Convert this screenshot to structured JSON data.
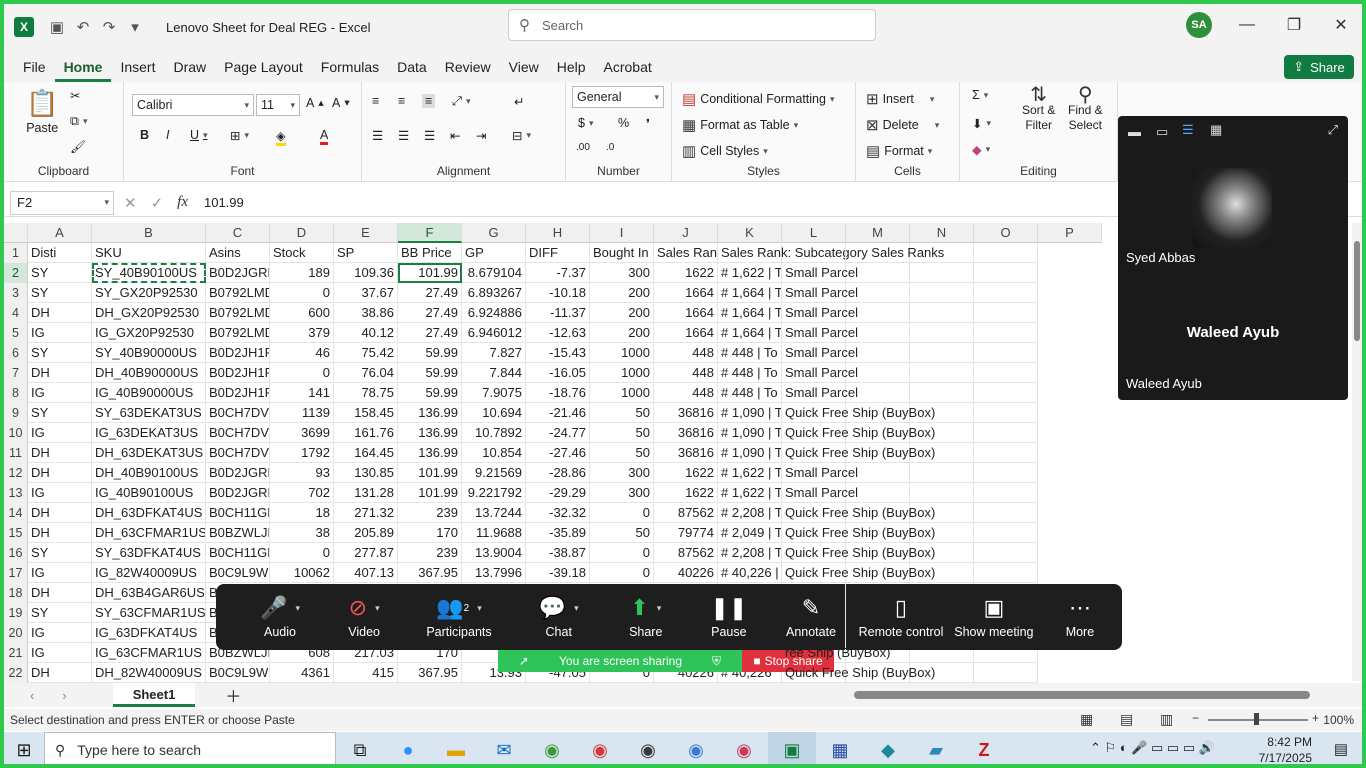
{
  "app": {
    "title": "Lenovo Sheet for Deal REG  -  Excel",
    "search_placeholder": "Search",
    "user_initials": "SA",
    "share_label": "Share"
  },
  "ribbon_tabs": [
    "File",
    "Home",
    "Insert",
    "Draw",
    "Page Layout",
    "Formulas",
    "Data",
    "Review",
    "View",
    "Help",
    "Acrobat"
  ],
  "ribbon": {
    "clipboard": {
      "paste": "Paste",
      "label": "Clipboard"
    },
    "font": {
      "name": "Calibri",
      "size": "11",
      "label": "Font"
    },
    "alignment": {
      "label": "Alignment"
    },
    "number": {
      "format": "General",
      "label": "Number"
    },
    "styles": {
      "conditional": "Conditional Formatting",
      "format_table": "Format as Table",
      "cell_styles": "Cell Styles",
      "label": "Styles"
    },
    "cells": {
      "insert": "Insert",
      "delete": "Delete",
      "format": "Format",
      "label": "Cells"
    },
    "editing": {
      "sort": "Sort &",
      "filter": "Filter",
      "find": "Find &",
      "select": "Select",
      "label": "Editing"
    }
  },
  "formula_bar": {
    "name_box": "F2",
    "value": "101.99"
  },
  "columns": [
    "A",
    "B",
    "C",
    "D",
    "E",
    "F",
    "G",
    "H",
    "I",
    "J",
    "K",
    "L",
    "M",
    "N",
    "O",
    "P"
  ],
  "rows": [
    {
      "n": "1",
      "cells": [
        "Disti",
        "SKU",
        "Asins",
        "Stock",
        "SP",
        "BB Price",
        "GP",
        "DIFF",
        "Bought In",
        "Sales Ranl",
        "Sales Rank: Subcategory Sales Ranks",
        "",
        "",
        "",
        ""
      ]
    },
    {
      "n": "2",
      "cells": [
        "SY",
        "SY_40B90100US",
        "B0D2JGRK",
        "189",
        "109.36",
        "101.99",
        "8.679104",
        "-7.37",
        "300",
        "1622",
        "# 1,622  |  T",
        "Small Parcel",
        "",
        "",
        ""
      ]
    },
    {
      "n": "3",
      "cells": [
        "SY",
        "SY_GX20P92530",
        "B0792LMD",
        "0",
        "37.67",
        "27.49",
        "6.893267",
        "-10.18",
        "200",
        "1664",
        "# 1,664  |  T",
        "Small Parcel",
        "",
        "",
        ""
      ]
    },
    {
      "n": "4",
      "cells": [
        "DH",
        "DH_GX20P92530",
        "B0792LMD",
        "600",
        "38.86",
        "27.49",
        "6.924886",
        "-11.37",
        "200",
        "1664",
        "# 1,664  |  T",
        "Small Parcel",
        "",
        "",
        ""
      ]
    },
    {
      "n": "5",
      "cells": [
        "IG",
        "IG_GX20P92530",
        "B0792LMD",
        "379",
        "40.12",
        "27.49",
        "6.946012",
        "-12.63",
        "200",
        "1664",
        "# 1,664  |  T",
        "Small Parcel",
        "",
        "",
        ""
      ]
    },
    {
      "n": "6",
      "cells": [
        "SY",
        "SY_40B90000US",
        "B0D2JH1R",
        "46",
        "75.42",
        "59.99",
        "7.827",
        "-15.43",
        "1000",
        "448",
        "# 448  |  To",
        "Small Parcel",
        "",
        "",
        ""
      ]
    },
    {
      "n": "7",
      "cells": [
        "DH",
        "DH_40B90000US",
        "B0D2JH1R",
        "0",
        "76.04",
        "59.99",
        "7.844",
        "-16.05",
        "1000",
        "448",
        "# 448  |  To",
        "Small Parcel",
        "",
        "",
        ""
      ]
    },
    {
      "n": "8",
      "cells": [
        "IG",
        "IG_40B90000US",
        "B0D2JH1R",
        "141",
        "78.75",
        "59.99",
        "7.9075",
        "-18.76",
        "1000",
        "448",
        "# 448  |  To",
        "Small Parcel",
        "",
        "",
        ""
      ]
    },
    {
      "n": "9",
      "cells": [
        "SY",
        "SY_63DEKAT3US",
        "B0CH7DVI",
        "1139",
        "158.45",
        "136.99",
        "10.694",
        "-21.46",
        "50",
        "36816",
        "# 1,090  |  T",
        "Quick Free Ship (BuyBox)",
        "",
        "",
        ""
      ]
    },
    {
      "n": "10",
      "cells": [
        "IG",
        "IG_63DEKAT3US",
        "B0CH7DVI",
        "3699",
        "161.76",
        "136.99",
        "10.7892",
        "-24.77",
        "50",
        "36816",
        "# 1,090  |  T",
        "Quick Free Ship (BuyBox)",
        "",
        "",
        ""
      ]
    },
    {
      "n": "11",
      "cells": [
        "DH",
        "DH_63DEKAT3US",
        "B0CH7DVI",
        "1792",
        "164.45",
        "136.99",
        "10.854",
        "-27.46",
        "50",
        "36816",
        "# 1,090  |  T",
        "Quick Free Ship (BuyBox)",
        "",
        "",
        ""
      ]
    },
    {
      "n": "12",
      "cells": [
        "DH",
        "DH_40B90100US",
        "B0D2JGRK",
        "93",
        "130.85",
        "101.99",
        "9.21569",
        "-28.86",
        "300",
        "1622",
        "# 1,622  |  T",
        "Small Parcel",
        "",
        "",
        ""
      ]
    },
    {
      "n": "13",
      "cells": [
        "IG",
        "IG_40B90100US",
        "B0D2JGRK",
        "702",
        "131.28",
        "101.99",
        "9.221792",
        "-29.29",
        "300",
        "1622",
        "# 1,622  |  T",
        "Small Parcel",
        "",
        "",
        ""
      ]
    },
    {
      "n": "14",
      "cells": [
        "DH",
        "DH_63DFKAT4US",
        "B0CH11GL",
        "18",
        "271.32",
        "239",
        "13.7244",
        "-32.32",
        "0",
        "87562",
        "# 2,208  |  T",
        "Quick Free Ship (BuyBox)",
        "",
        "",
        ""
      ]
    },
    {
      "n": "15",
      "cells": [
        "DH",
        "DH_63CFMAR1US",
        "B0BZWLJF",
        "38",
        "205.89",
        "170",
        "11.9688",
        "-35.89",
        "50",
        "79774",
        "# 2,049  |  T",
        "Quick Free Ship (BuyBox)",
        "",
        "",
        ""
      ]
    },
    {
      "n": "16",
      "cells": [
        "SY",
        "SY_63DFKAT4US",
        "B0CH11GL",
        "0",
        "277.87",
        "239",
        "13.9004",
        "-38.87",
        "0",
        "87562",
        "# 2,208  |  T",
        "Quick Free Ship (BuyBox)",
        "",
        "",
        ""
      ]
    },
    {
      "n": "17",
      "cells": [
        "IG",
        "IG_82W40009US",
        "B0C9L9WI",
        "10062",
        "407.13",
        "367.95",
        "13.7996",
        "-39.18",
        "0",
        "40226",
        "# 40,226  |",
        "Quick Free Ship (BuyBox)",
        "",
        "",
        ""
      ]
    },
    {
      "n": "18",
      "cells": [
        "DH",
        "DH_63B4GAR6US",
        "B",
        "",
        "",
        "",
        "",
        "",
        "",
        "",
        "",
        "",
        "",
        "",
        ""
      ]
    },
    {
      "n": "19",
      "cells": [
        "SY",
        "SY_63CFMAR1US",
        "B",
        "",
        "",
        "",
        "",
        "",
        "",
        "",
        "",
        "",
        "",
        "",
        ""
      ]
    },
    {
      "n": "20",
      "cells": [
        "IG",
        "IG_63DFKAT4US",
        "B",
        "",
        "",
        "",
        "",
        "",
        "",
        "",
        "",
        "",
        "",
        "",
        ""
      ]
    },
    {
      "n": "21",
      "cells": [
        "IG",
        "IG_63CFMAR1US",
        "B0BZWLJF",
        "608",
        "217.03",
        "170",
        "12.",
        "",
        "",
        "",
        "",
        "ree Ship (BuyBox)",
        "",
        "",
        ""
      ]
    },
    {
      "n": "22",
      "cells": [
        "DH",
        "DH_82W40009US",
        "B0C9L9WI",
        "4361",
        "415",
        "367.95",
        "13.93",
        "-47.05",
        "0",
        "40226",
        "# 40,226",
        "Quick Free Ship (BuyBox)",
        "",
        "",
        ""
      ]
    }
  ],
  "sheet": {
    "tab": "Sheet1"
  },
  "status": {
    "message": "Select destination and press ENTER or choose Paste",
    "zoom": "100%"
  },
  "taskbar": {
    "search_placeholder": "Type here to search",
    "time": "8:42 PM",
    "date": "7/17/2025"
  },
  "meeting": {
    "participant_1": "Syed Abbas",
    "participant_2_center": "Waleed Ayub",
    "participant_2_label": "Waleed Ayub",
    "participants_count": "2",
    "controls": [
      "Audio",
      "Video",
      "Participants",
      "Chat",
      "Share",
      "Pause",
      "Annotate",
      "Remote control",
      "Show meeting",
      "More"
    ],
    "sharing_text": "You are screen sharing",
    "stop_share": "Stop share"
  },
  "colors": {
    "excel_green": "#107c41",
    "sharing_green": "#2ec45a",
    "stop_red": "#e0303d"
  }
}
